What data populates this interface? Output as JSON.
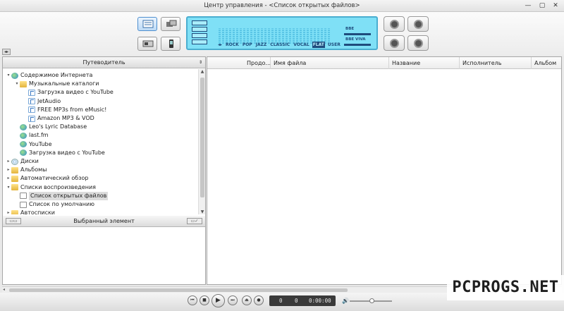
{
  "window": {
    "title": "Центр управления - <Список открытых файлов>",
    "controls": {
      "minimize": "—",
      "maximize": "▢",
      "close": "✕"
    }
  },
  "toolbar": {
    "left_buttons": [
      {
        "name": "view-library-button",
        "active": true
      },
      {
        "name": "view-mini-button",
        "active": false
      },
      {
        "name": "view-skin-button",
        "active": false
      },
      {
        "name": "view-device-button",
        "active": false
      }
    ],
    "right_buttons": [
      {
        "name": "record-button"
      },
      {
        "name": "convert-button"
      },
      {
        "name": "broadcast-button"
      },
      {
        "name": "settings-button"
      }
    ]
  },
  "equalizer": {
    "presets": [
      "ROCK",
      "POP",
      "JAZZ",
      "CLASSIC",
      "VOCAL",
      "FLAT",
      "USER"
    ],
    "selected_preset": "FLAT",
    "bbe_label": "BBE",
    "bbe_viva_label": "BBE VIVA",
    "band_levels": [
      0.5,
      0.55,
      0.5,
      0.6,
      0.5,
      0.55,
      0.5,
      0.5,
      0.55,
      0.5,
      0.5,
      0.55,
      0.5,
      0.5,
      0.55,
      0.5,
      0.5,
      0.55,
      0.5,
      0.5,
      0.55,
      0.5,
      0.5,
      0.55,
      0.5,
      0.5,
      0.55,
      0.5,
      0.5,
      0.55,
      0.5,
      0.5
    ]
  },
  "sidebar": {
    "header": "Путеводитель",
    "tree": [
      {
        "label": "Содержимое Интернета",
        "icon": "globe-icon",
        "level": 0,
        "expanded": true
      },
      {
        "label": "Музыкальные каталоги",
        "icon": "folder-icon",
        "level": 1,
        "expanded": true
      },
      {
        "label": "Загрузка видео с YouTube",
        "icon": "note-icon",
        "level": 2
      },
      {
        "label": "JetAudio",
        "icon": "note-icon",
        "level": 2
      },
      {
        "label": "FREE MP3s from eMusic!",
        "icon": "note-icon",
        "level": 2
      },
      {
        "label": "Amazon MP3 & VOD",
        "icon": "note-icon",
        "level": 2
      },
      {
        "label": "Leo's Lyric Database",
        "icon": "globe-icon",
        "level": 1
      },
      {
        "label": "last.fm",
        "icon": "globe-icon",
        "level": 1
      },
      {
        "label": "YouTube",
        "icon": "globe-icon",
        "level": 1
      },
      {
        "label": "Загрузка видео с YouTube",
        "icon": "globe-icon",
        "level": 1
      },
      {
        "label": "Диски",
        "icon": "disc-icon",
        "level": 0,
        "expanded": false
      },
      {
        "label": "Альбомы",
        "icon": "folder-icon",
        "level": 0,
        "expanded": false
      },
      {
        "label": "Автоматический обзор",
        "icon": "folder-icon",
        "level": 0,
        "expanded": false
      },
      {
        "label": "Списки воспроизведения",
        "icon": "folder-icon",
        "level": 0,
        "expanded": true
      },
      {
        "label": "Список открытых файлов",
        "icon": "list-icon",
        "level": 1,
        "selected": true
      },
      {
        "label": "Список по умолчанию",
        "icon": "list-icon",
        "level": 1
      },
      {
        "label": "Автосписки",
        "icon": "folder-icon",
        "level": 0,
        "expanded": false
      }
    ],
    "selected_item_header": "Выбранный элемент"
  },
  "filelist": {
    "columns": [
      "Продо...",
      "Имя файла",
      "Название",
      "Исполнитель",
      "Альбом"
    ]
  },
  "player": {
    "buttons": {
      "prev": "⏮",
      "stop": "■",
      "play": "▶",
      "next": "⏭",
      "open": "⏏",
      "repeat": "●"
    },
    "time": {
      "track": "0",
      "counter": "0",
      "elapsed": "0:00:00"
    },
    "volume_icon": "🔊",
    "volume_level": 0.5
  },
  "watermark": "PCPROGS.NET"
}
